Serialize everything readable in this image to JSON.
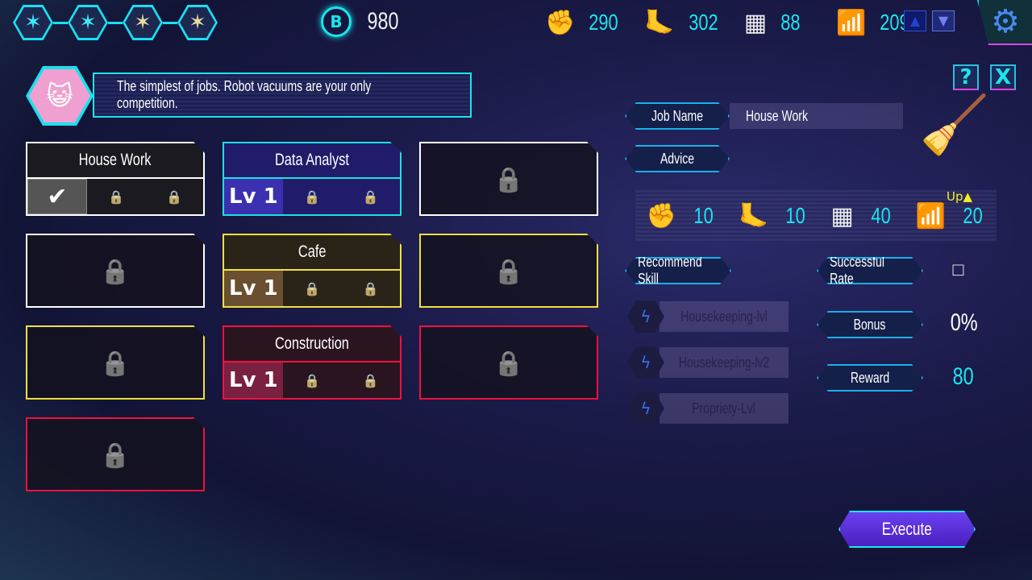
{
  "header": {
    "stars": [
      {
        "color": "#3fe8f5"
      },
      {
        "color": "#3fe8f5"
      },
      {
        "color": "#e6dca0"
      },
      {
        "color": "#e6dca0"
      }
    ],
    "currency_icon": "B",
    "currency": "980",
    "stats": [
      {
        "icon": "fist-icon",
        "glyph": "✊",
        "value": "290"
      },
      {
        "icon": "foot-icon",
        "glyph": "🦶",
        "value": "302"
      },
      {
        "icon": "calculator-icon",
        "glyph": "▦",
        "value": "88"
      },
      {
        "icon": "chart-up-icon",
        "glyph": "📶",
        "value": "209"
      }
    ],
    "settings_icon": "⚙"
  },
  "dialog": {
    "text": "The simplest of jobs. Robot vacuums are your only competition."
  },
  "buttons": {
    "help": "?",
    "close": "X",
    "execute": "Execute"
  },
  "jobs": [
    {
      "title": "House Work",
      "border": "#ffffff",
      "fill": "#1a1a20",
      "state": "selected",
      "lock": "#555"
    },
    {
      "title": "Data Analyst",
      "border": "#20e0e0",
      "fill": "#201c6a",
      "state": "lv",
      "lv": "Lv 1",
      "lvbg": "#3a30b0",
      "lock": "#3a6ad8"
    },
    {
      "title": "",
      "border": "#ffffff",
      "state": "locked",
      "lock": "#555"
    },
    {
      "title": "",
      "border": "#ffffff",
      "state": "locked",
      "lock": "#555"
    },
    {
      "title": "Cafe",
      "border": "#f0e040",
      "fill": "#2a2418",
      "state": "lv",
      "lv": "Lv 1",
      "lvbg": "#6a5030",
      "lock": "#8a6a30"
    },
    {
      "title": "",
      "border": "#f0e040",
      "state": "locked",
      "lock": "#8a6a30"
    },
    {
      "title": "",
      "border": "#f0e040",
      "state": "locked",
      "lock": "#8a6a30"
    },
    {
      "title": "Construction",
      "border": "#f01040",
      "fill": "#2a1420",
      "state": "lv",
      "lv": "Lv 1",
      "lvbg": "#7a2040",
      "lock": "#8a2a48"
    },
    {
      "title": "",
      "border": "#f01040",
      "state": "locked",
      "lock": "#8a2a48"
    },
    {
      "title": "",
      "border": "#f01040",
      "state": "locked",
      "lock": "#8a2a48"
    }
  ],
  "detail": {
    "job_name_label": "Job Name",
    "job_name": "House Work",
    "advice_label": "Advice",
    "req": [
      {
        "glyph": "✊",
        "value": "10"
      },
      {
        "glyph": "🦶",
        "value": "10"
      },
      {
        "glyph": "▦",
        "value": "40"
      },
      {
        "glyph": "📶",
        "value": "20"
      }
    ],
    "up_label": "Up▲",
    "recommend_label": "Recommend Skill",
    "skills": [
      "Housekeeping-lvl",
      "Housekeeping-lv2",
      "Propriety-Lvl"
    ],
    "success_label": "Successful Rate",
    "success_value": "□",
    "bonus_label": "Bonus",
    "bonus_value": "0%",
    "reward_label": "Reward",
    "reward_value": "80"
  }
}
